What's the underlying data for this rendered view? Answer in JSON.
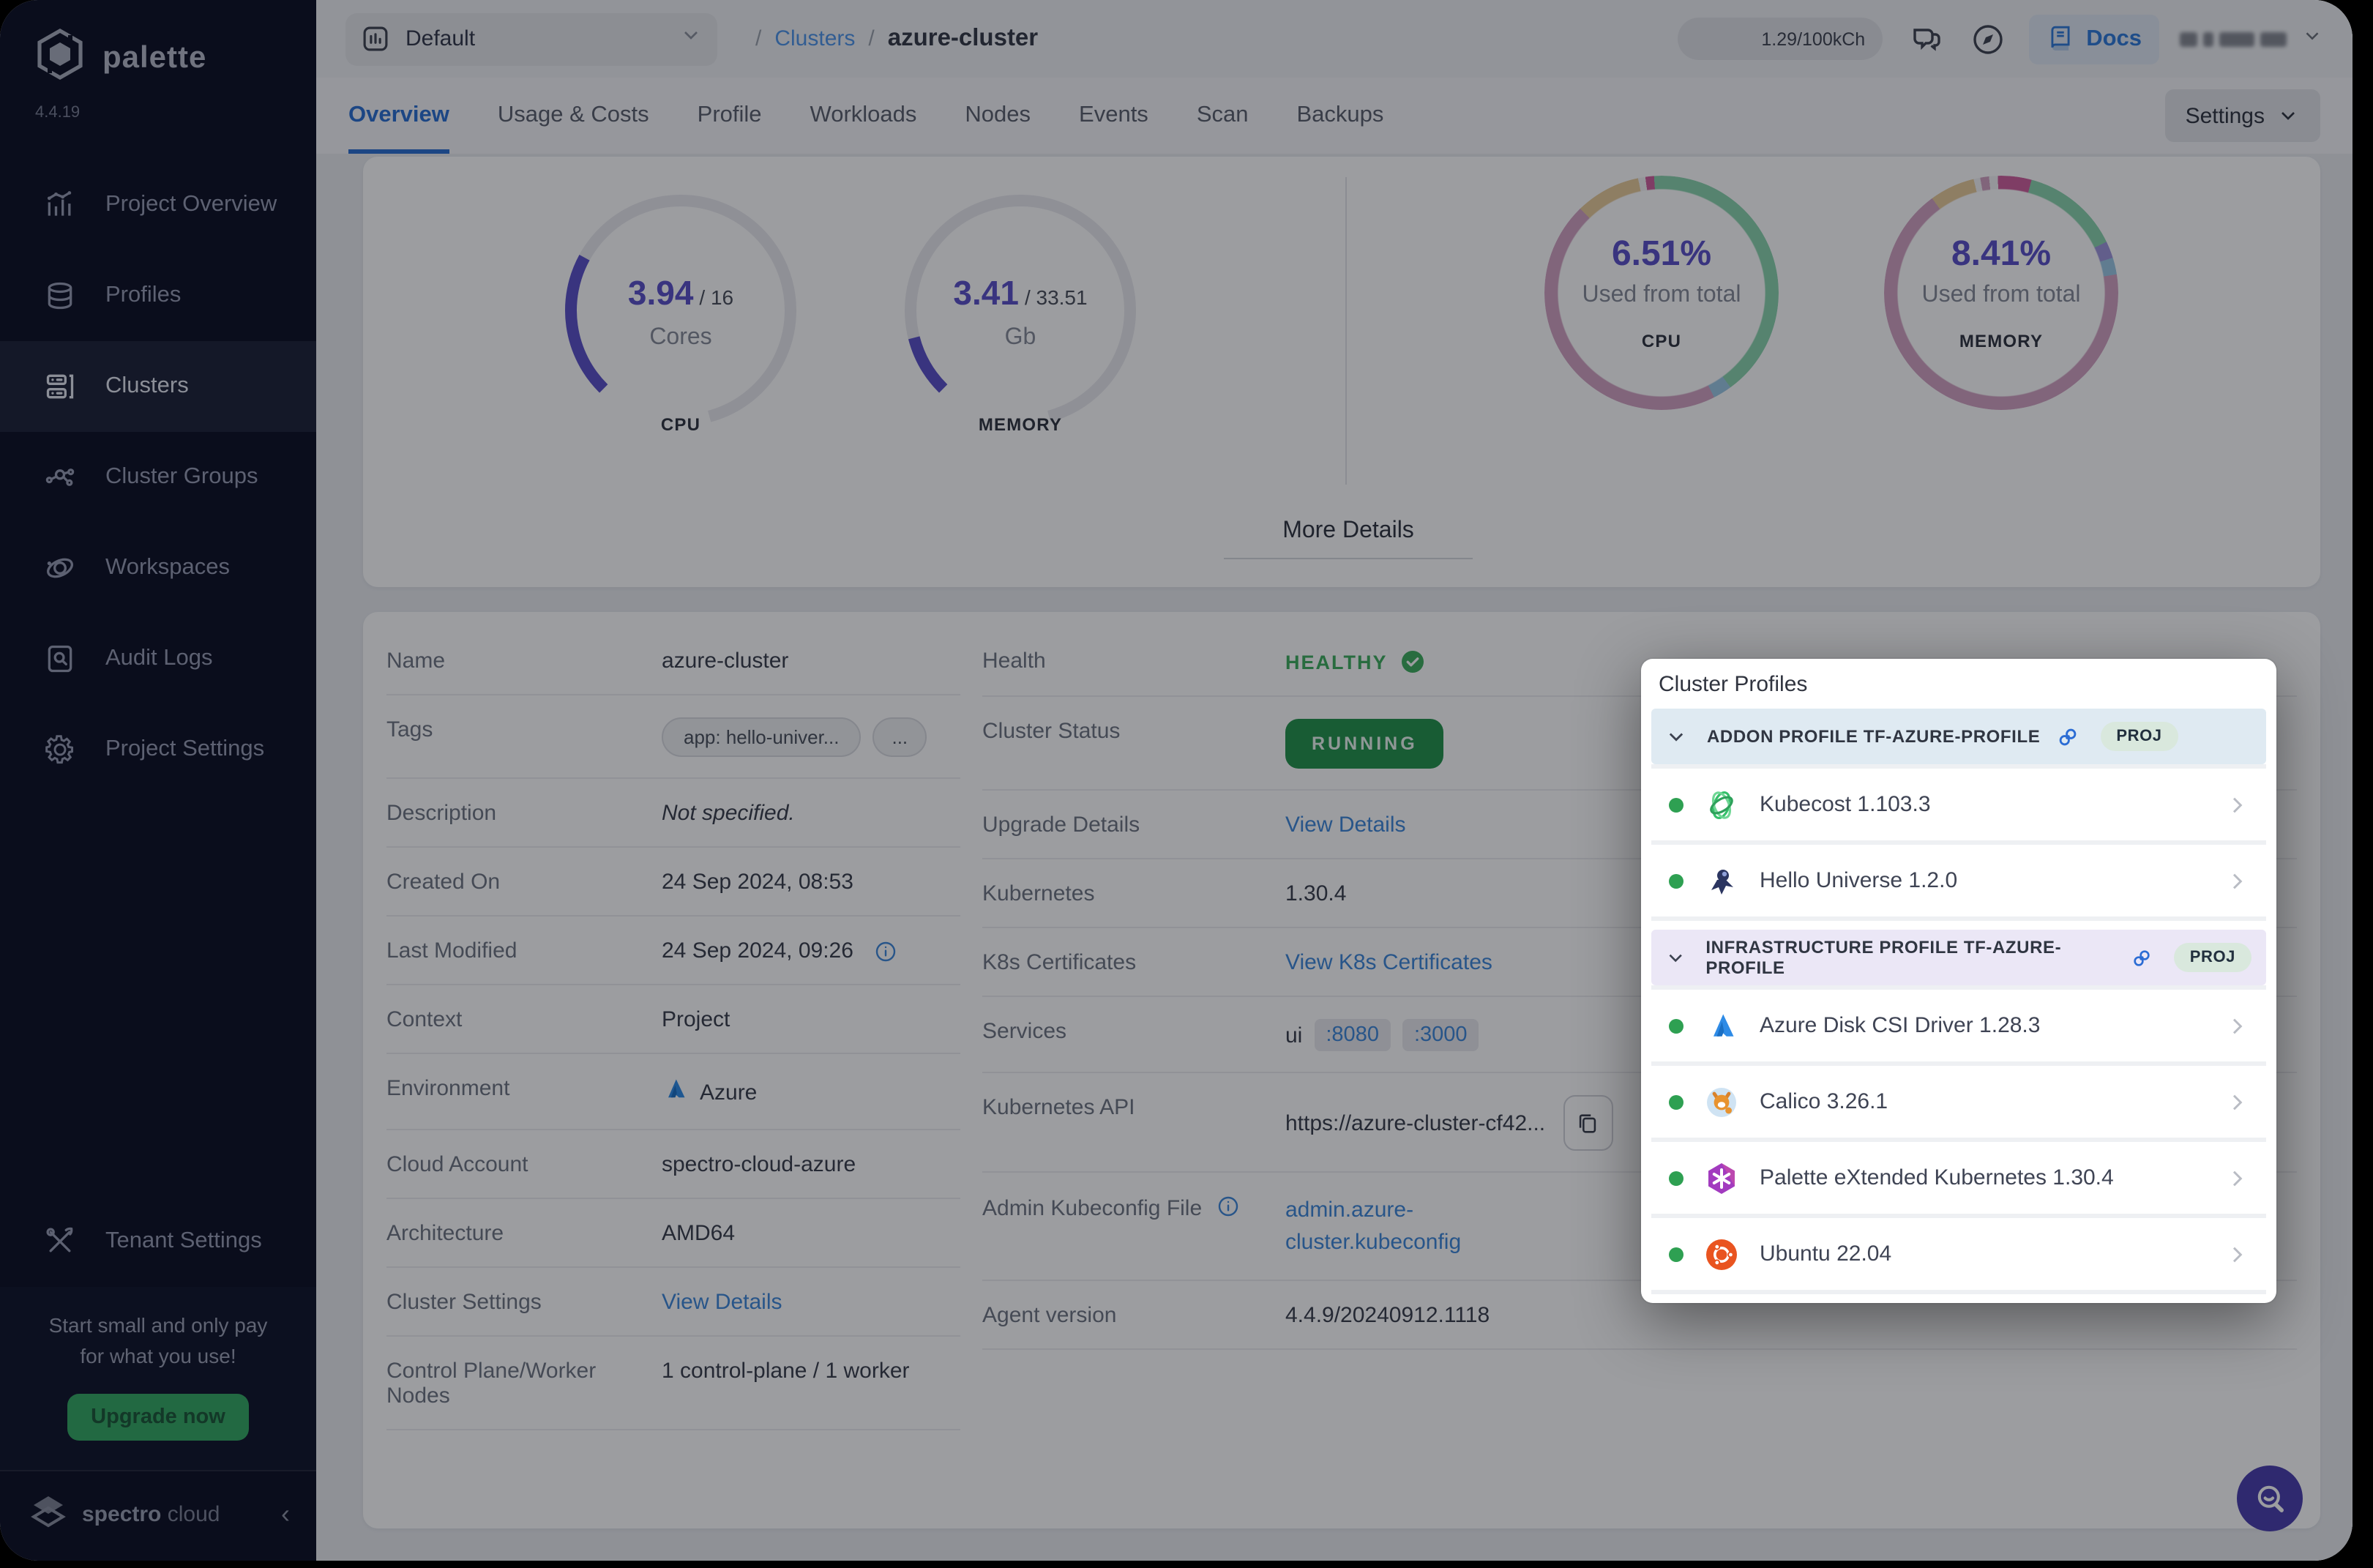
{
  "sidebar": {
    "brand": "palette",
    "version": "4.4.19",
    "items": [
      {
        "label": "Project Overview"
      },
      {
        "label": "Profiles"
      },
      {
        "label": "Clusters"
      },
      {
        "label": "Cluster Groups"
      },
      {
        "label": "Workspaces"
      },
      {
        "label": "Audit Logs"
      },
      {
        "label": "Project Settings"
      }
    ],
    "tenant_settings": "Tenant Settings",
    "promo_line1": "Start small and only pay",
    "promo_line2": "for what you use!",
    "upgrade_button": "Upgrade now",
    "footer_brand_bold": "spectro",
    "footer_brand_light": "cloud"
  },
  "topbar": {
    "project_selector": "Default",
    "breadcrumb_sep1": "/",
    "breadcrumb_parent": "Clusters",
    "breadcrumb_sep2": "/",
    "breadcrumb_current": "azure-cluster",
    "usage_pill": "1.29/100kCh",
    "docs": "Docs"
  },
  "tabs": {
    "items": [
      {
        "label": "Overview"
      },
      {
        "label": "Usage & Costs"
      },
      {
        "label": "Profile"
      },
      {
        "label": "Workloads"
      },
      {
        "label": "Nodes"
      },
      {
        "label": "Events"
      },
      {
        "label": "Scan"
      },
      {
        "label": "Backups"
      }
    ],
    "settings": "Settings"
  },
  "overview_card": {
    "gauges": [
      {
        "value": "3.94",
        "total": "/ 16",
        "unit": "Cores",
        "metric": "CPU",
        "percent": 24.6,
        "color": "#5b51c9",
        "track": "#e9e9ee"
      },
      {
        "value": "3.41",
        "total": "/ 33.51",
        "unit": "Gb",
        "metric": "MEMORY",
        "percent": 10.2,
        "color": "#5b51c9",
        "track": "#e9e9ee"
      }
    ],
    "donuts": [
      {
        "percent": "6.51%",
        "caption": "Used from total",
        "metric": "CPU",
        "start": -8,
        "segments": [
          {
            "color": "#cf5f9d",
            "value": 1.2
          },
          {
            "color": "#8bd4ad",
            "value": 41
          },
          {
            "color": "#9cc8e4",
            "value": 2.6
          },
          {
            "color": "#d3a2c2",
            "value": 45.2
          },
          {
            "color": "#e8cb9a",
            "value": 9
          },
          {
            "color": "#f4f4f6",
            "value": 1
          }
        ]
      },
      {
        "percent": "8.41%",
        "caption": "Used from total",
        "metric": "MEMORY",
        "start": -6,
        "segments": [
          {
            "color": "#f4f4f6",
            "value": 1.2
          },
          {
            "color": "#cf5f9d",
            "value": 4.6
          },
          {
            "color": "#8bd4ad",
            "value": 13.5
          },
          {
            "color": "#9f97dd",
            "value": 2.3
          },
          {
            "color": "#9cc8e4",
            "value": 2.3
          },
          {
            "color": "#d3a2c2",
            "value": 66.8
          },
          {
            "color": "#e8cb9a",
            "value": 6.2
          },
          {
            "color": "#f4f4f6",
            "value": 0.9
          },
          {
            "color": "#d3a2c2",
            "value": 1.2
          }
        ]
      }
    ],
    "more_details": "More Details"
  },
  "details": {
    "left": [
      {
        "label": "Name",
        "value": "azure-cluster"
      },
      {
        "label": "Tags",
        "tag1": "app: hello-univer...",
        "tag2": "..."
      },
      {
        "label": "Description",
        "value": "Not specified."
      },
      {
        "label": "Created On",
        "value": "24 Sep 2024, 08:53"
      },
      {
        "label": "Last Modified",
        "value": "24 Sep 2024, 09:26"
      },
      {
        "label": "Context",
        "value": "Project"
      },
      {
        "label": "Environment",
        "value": "Azure"
      },
      {
        "label": "Cloud Account",
        "value": "spectro-cloud-azure"
      },
      {
        "label": "Architecture",
        "value": "AMD64"
      },
      {
        "label": "Cluster Settings",
        "value": "View Details"
      },
      {
        "label": "Control Plane/Worker Nodes",
        "value": "1 control-plane / 1 worker"
      }
    ],
    "right": [
      {
        "label": "Health",
        "value": "HEALTHY"
      },
      {
        "label": "Cluster Status",
        "value": "RUNNING"
      },
      {
        "label": "Upgrade Details",
        "value": "View Details"
      },
      {
        "label": "Kubernetes",
        "value": "1.30.4"
      },
      {
        "label": "K8s Certificates",
        "value": "View K8s Certificates"
      },
      {
        "label": "Services",
        "prefix": "ui",
        "port1": ":8080",
        "port2": ":3000"
      },
      {
        "label": "Kubernetes API",
        "value": "https://azure-cluster-cf42..."
      },
      {
        "label": "Admin Kubeconfig File",
        "line1": "admin.azure-",
        "line2": "cluster.kubeconfig"
      },
      {
        "label": "Agent version",
        "value": "4.4.9/20240912.1118"
      }
    ]
  },
  "profiles_popup": {
    "title": "Cluster Profiles",
    "sections": [
      {
        "header": "ADDON PROFILE TF-AZURE-PROFILE",
        "badge": "PROJ",
        "rows": [
          {
            "name": "Kubecost 1.103.3"
          },
          {
            "name": "Hello Universe 1.2.0"
          }
        ]
      },
      {
        "header": "INFRASTRUCTURE PROFILE TF-AZURE-PROFILE",
        "badge": "PROJ",
        "rows": [
          {
            "name": "Azure Disk CSI Driver 1.28.3"
          },
          {
            "name": "Calico 3.26.1"
          },
          {
            "name": "Palette eXtended Kubernetes 1.30.4"
          },
          {
            "name": "Ubuntu 22.04"
          }
        ]
      }
    ]
  }
}
